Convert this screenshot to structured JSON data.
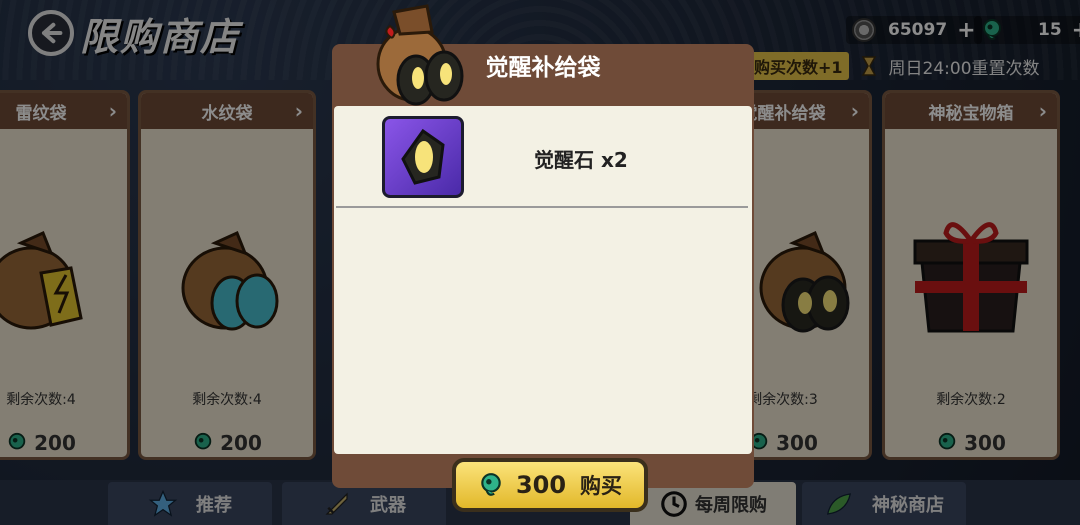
{
  "header": {
    "title": "限购商店",
    "coins": "65097",
    "gems": "15",
    "buy_count": "购买次数+1",
    "reset_text": "周日24:00重置次数"
  },
  "cards": [
    {
      "name": "雷纹袋",
      "remain": "剩余次数:4",
      "price": "200"
    },
    {
      "name": "水纹袋",
      "remain": "剩余次数:4",
      "price": "200"
    },
    {
      "name": "觉醒补给袋",
      "remain": "剩余次数:3",
      "price": "300"
    },
    {
      "name": "神秘宝物箱",
      "remain": "剩余次数:2",
      "price": "300"
    }
  ],
  "tabs": [
    {
      "label": "推荐"
    },
    {
      "label": "武器"
    },
    {
      "label": "每周限购"
    },
    {
      "label": "神秘商店"
    }
  ],
  "modal": {
    "title": "觉醒补给袋",
    "reward_name": "觉醒石 x2",
    "buy_price": "300",
    "buy_label": "购买"
  },
  "colors": {
    "panel_brown": "#6f4b38",
    "card_bg": "#efe6d2",
    "buy_yellow": "#f4cf4a",
    "gem_green": "#2fb38a"
  }
}
